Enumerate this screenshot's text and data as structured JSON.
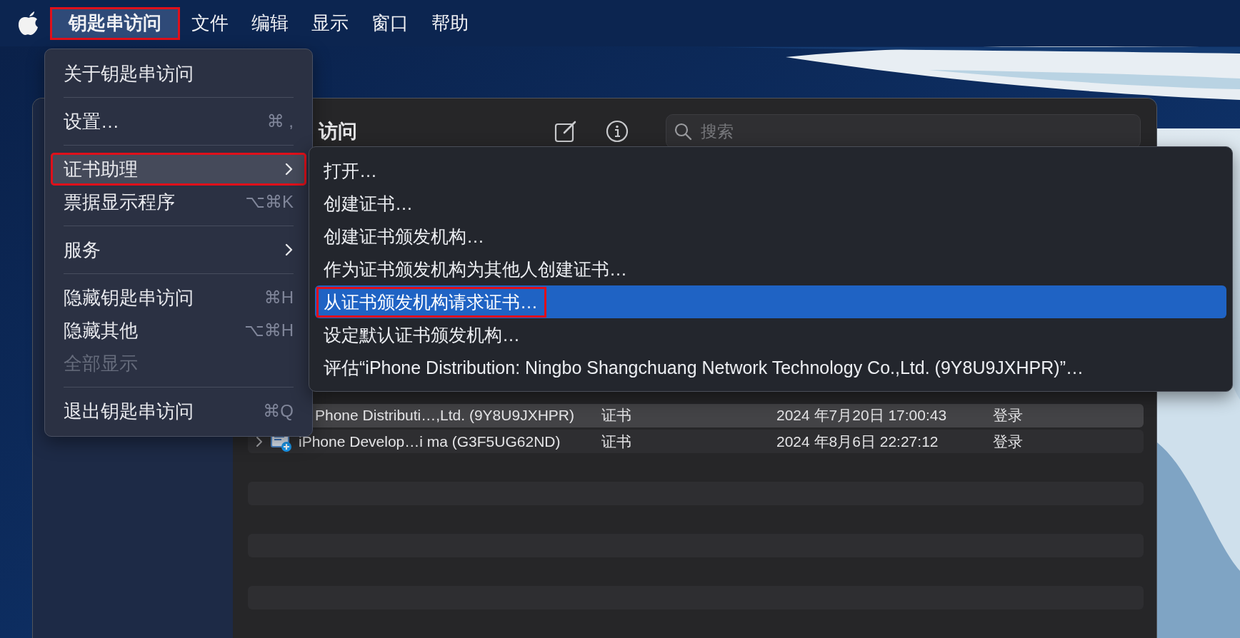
{
  "menu_bar": {
    "items": [
      {
        "label": "钥匙串访问",
        "selected": true
      },
      {
        "label": "文件",
        "selected": false
      },
      {
        "label": "编辑",
        "selected": false
      },
      {
        "label": "显示",
        "selected": false
      },
      {
        "label": "窗口",
        "selected": false
      },
      {
        "label": "帮助",
        "selected": false
      }
    ]
  },
  "window": {
    "title": "访问",
    "search": {
      "placeholder": "搜索"
    },
    "table": {
      "rows": [
        {
          "name": "Phone Distributi…,Ltd. (9Y8U9JXHPR)",
          "kind": "证书",
          "date": "2024 年7月20日 17:00:43",
          "keychain": "登录",
          "selected": true,
          "expandable": false
        },
        {
          "name": "iPhone Develop…i ma (G3F5UG62ND)",
          "kind": "证书",
          "date": "2024 年8月6日 22:27:12",
          "keychain": "登录",
          "selected": false,
          "expandable": true
        }
      ]
    }
  },
  "app_menu": {
    "items": [
      {
        "kind": "item",
        "label": "关于钥匙串访问",
        "selected": false,
        "disabled": false,
        "submenu": false
      },
      {
        "kind": "separator"
      },
      {
        "kind": "item",
        "label": "设置…",
        "shortcut": "⌘ ,",
        "selected": false,
        "disabled": false,
        "submenu": false
      },
      {
        "kind": "separator"
      },
      {
        "kind": "item",
        "label": "证书助理",
        "selected": true,
        "disabled": false,
        "submenu": true
      },
      {
        "kind": "item",
        "label": "票据显示程序",
        "shortcut": "⌥⌘K",
        "selected": false,
        "disabled": false,
        "submenu": false
      },
      {
        "kind": "separator"
      },
      {
        "kind": "item",
        "label": "服务",
        "selected": false,
        "disabled": false,
        "submenu": true
      },
      {
        "kind": "separator"
      },
      {
        "kind": "item",
        "label": "隐藏钥匙串访问",
        "shortcut": "⌘H",
        "selected": false,
        "disabled": false,
        "submenu": false
      },
      {
        "kind": "item",
        "label": "隐藏其他",
        "shortcut": "⌥⌘H",
        "selected": false,
        "disabled": false,
        "submenu": false
      },
      {
        "kind": "item",
        "label": "全部显示",
        "selected": false,
        "disabled": true,
        "submenu": false
      },
      {
        "kind": "separator"
      },
      {
        "kind": "item",
        "label": "退出钥匙串访问",
        "shortcut": "⌘Q",
        "selected": false,
        "disabled": false,
        "submenu": false
      }
    ]
  },
  "submenu": {
    "items": [
      {
        "label": "打开…",
        "selected": false
      },
      {
        "label": "创建证书…",
        "selected": false
      },
      {
        "label": "创建证书颁发机构…",
        "selected": false
      },
      {
        "label": "作为证书颁发机构为其他人创建证书…",
        "selected": false
      },
      {
        "label": "从证书颁发机构请求证书…",
        "selected": true
      },
      {
        "label": "设定默认证书颁发机构…",
        "selected": false
      },
      {
        "label": "评估“iPhone Distribution: Ningbo Shangchuang Network Technology Co.,Ltd. (9Y8U9JXHPR)”…",
        "selected": false
      }
    ]
  }
}
